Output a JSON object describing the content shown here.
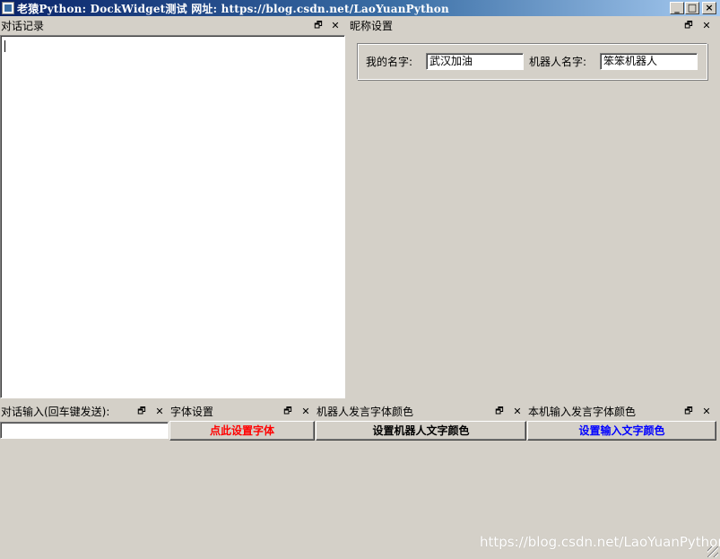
{
  "window": {
    "title": "老猿Python: DockWidget测试   网址: https://blog.csdn.net/LaoYuanPython",
    "controls": {
      "minimize": "_",
      "maximize": "□",
      "close": "×"
    }
  },
  "docks": {
    "chat_log": {
      "title": "对话记录"
    },
    "nickname": {
      "title": "昵称设置",
      "my_name_label": "我的名字:",
      "my_name_value": "武汉加油",
      "robot_name_label": "机器人名字:",
      "robot_name_value": "笨笨机器人"
    },
    "chat_input": {
      "title": "对话输入(回车键发送):",
      "value": ""
    },
    "font": {
      "title": "字体设置",
      "button_label": "点此设置字体"
    },
    "robot_color": {
      "title": "机器人发言字体颜色",
      "button_label": "设置机器人文字颜色"
    },
    "input_color": {
      "title": "本机输入发言字体颜色",
      "button_label": "设置输入文字颜色"
    }
  },
  "dock_icons": {
    "float": "🗗",
    "close": "✕"
  },
  "watermark": "https://blog.csdn.net/LaoYuanPython",
  "colors": {
    "font_button": "#ff0000",
    "robot_button": "#000000",
    "input_button": "#0000ff",
    "titlebar": "#0a246a"
  }
}
